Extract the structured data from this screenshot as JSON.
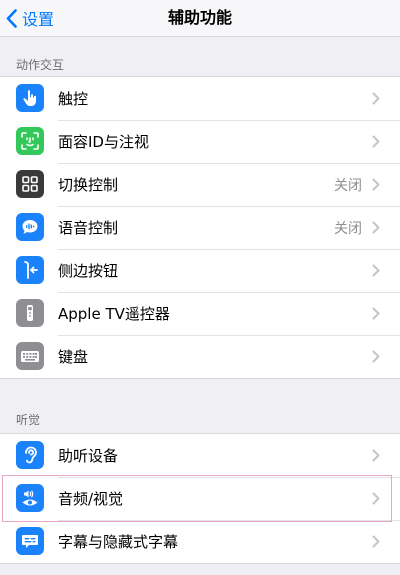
{
  "navbar": {
    "back_label": "设置",
    "title": "辅助功能"
  },
  "sections": {
    "interaction": {
      "header": "动作交互",
      "items": [
        {
          "label": "触控",
          "value": "",
          "icon": "touch-hand-icon",
          "color": "#1a82fb"
        },
        {
          "label": "面容ID与注视",
          "value": "",
          "icon": "face-id-icon",
          "color": "#34c759"
        },
        {
          "label": "切换控制",
          "value": "关闭",
          "icon": "switch-control-icon",
          "color": "#3a3a3c"
        },
        {
          "label": "语音控制",
          "value": "关闭",
          "icon": "voice-control-icon",
          "color": "#1a82fb"
        },
        {
          "label": "侧边按钮",
          "value": "",
          "icon": "side-button-icon",
          "color": "#1a82fb"
        },
        {
          "label": "Apple TV遥控器",
          "value": "",
          "icon": "tv-remote-icon",
          "color": "#8e8e93"
        },
        {
          "label": "键盘",
          "value": "",
          "icon": "keyboard-icon",
          "color": "#8e8e93"
        }
      ]
    },
    "hearing": {
      "header": "听觉",
      "items": [
        {
          "label": "助听设备",
          "value": "",
          "icon": "hearing-ear-icon",
          "color": "#1a82fb"
        },
        {
          "label": "音频/视觉",
          "value": "",
          "icon": "audio-visual-icon",
          "color": "#1a82fb"
        },
        {
          "label": "字幕与隐藏式字幕",
          "value": "",
          "icon": "subtitles-icon",
          "color": "#1a82fb"
        }
      ]
    }
  },
  "colors": {
    "accent": "#007aff",
    "highlight_border": "#e8a5c6"
  }
}
